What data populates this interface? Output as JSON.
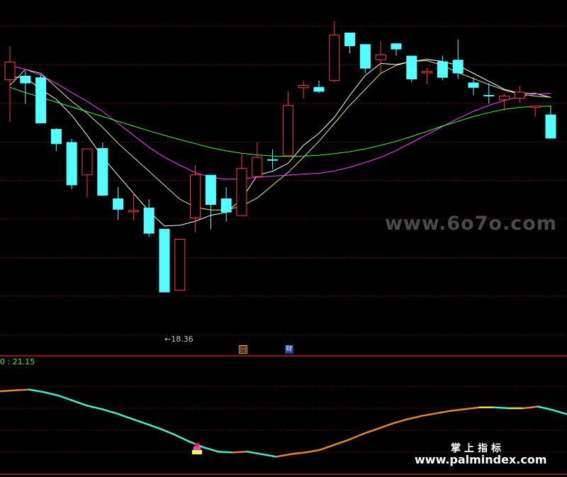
{
  "chart_data": {
    "type": "candlestick",
    "price_range": [
      16.6,
      24.9
    ],
    "candles": [
      {
        "o": 22.94,
        "h": 23.77,
        "l": 21.88,
        "c": 23.38
      },
      {
        "o": 23.04,
        "h": 23.16,
        "l": 22.34,
        "c": 22.85
      },
      {
        "o": 23.0,
        "h": 23.07,
        "l": 21.85,
        "c": 21.85
      },
      {
        "o": 21.71,
        "h": 21.73,
        "l": 21.16,
        "c": 21.33
      },
      {
        "o": 21.38,
        "h": 21.46,
        "l": 20.2,
        "c": 20.3
      },
      {
        "o": 20.56,
        "h": 21.04,
        "l": 20.0,
        "c": 21.21
      },
      {
        "o": 21.23,
        "h": 21.37,
        "l": 20.42,
        "c": 20.04
      },
      {
        "o": 19.97,
        "h": 20.25,
        "l": 19.44,
        "c": 19.69
      },
      {
        "o": 19.67,
        "h": 20.11,
        "l": 19.44,
        "c": 19.67
      },
      {
        "o": 19.74,
        "h": 19.95,
        "l": 19.01,
        "c": 19.09
      },
      {
        "o": 19.21,
        "h": 19.21,
        "l": 18.36,
        "c": 17.62
      },
      {
        "o": 17.67,
        "h": 18.95,
        "l": 17.67,
        "c": 18.95
      },
      {
        "o": 19.48,
        "h": 20.8,
        "l": 19.12,
        "c": 20.56
      },
      {
        "o": 20.56,
        "h": 20.56,
        "l": 19.2,
        "c": 19.81
      },
      {
        "o": 19.97,
        "h": 20.25,
        "l": 19.39,
        "c": 19.62
      },
      {
        "o": 19.54,
        "h": 21.1,
        "l": 19.54,
        "c": 20.72
      },
      {
        "o": 20.52,
        "h": 21.37,
        "l": 20.52,
        "c": 21.0
      },
      {
        "o": 20.95,
        "h": 21.2,
        "l": 20.7,
        "c": 20.93
      },
      {
        "o": 21.04,
        "h": 22.65,
        "l": 21.04,
        "c": 22.3
      },
      {
        "o": 22.74,
        "h": 22.91,
        "l": 22.47,
        "c": 22.8
      },
      {
        "o": 22.76,
        "h": 22.92,
        "l": 22.6,
        "c": 22.64
      },
      {
        "o": 22.92,
        "h": 24.4,
        "l": 22.88,
        "c": 24.06
      },
      {
        "o": 24.12,
        "h": 24.12,
        "l": 23.6,
        "c": 23.78
      },
      {
        "o": 23.83,
        "h": 23.83,
        "l": 23.11,
        "c": 23.22
      },
      {
        "o": 23.44,
        "h": 23.9,
        "l": 23.11,
        "c": 23.56
      },
      {
        "o": 23.85,
        "h": 23.85,
        "l": 23.54,
        "c": 23.7
      },
      {
        "o": 23.54,
        "h": 23.54,
        "l": 22.88,
        "c": 22.95
      },
      {
        "o": 23.11,
        "h": 23.23,
        "l": 22.83,
        "c": 23.15
      },
      {
        "o": 23.4,
        "h": 23.54,
        "l": 22.93,
        "c": 22.99
      },
      {
        "o": 23.44,
        "h": 23.95,
        "l": 22.96,
        "c": 23.1
      },
      {
        "o": 22.87,
        "h": 23.0,
        "l": 22.55,
        "c": 22.74
      },
      {
        "o": 22.56,
        "h": 22.85,
        "l": 22.34,
        "c": 22.53
      },
      {
        "o": 22.44,
        "h": 22.59,
        "l": 22.17,
        "c": 22.53
      },
      {
        "o": 22.48,
        "h": 22.78,
        "l": 22.37,
        "c": 22.63
      },
      {
        "o": 22.27,
        "h": 22.27,
        "l": 22.02,
        "c": 22.28
      },
      {
        "o": 22.07,
        "h": 22.29,
        "l": 21.69,
        "c": 21.47
      }
    ],
    "ma_lines": [
      {
        "name": "",
        "color": "#ffffff",
        "values": [
          23.0,
          23.0,
          22.7,
          22.45,
          22.05,
          21.55,
          21.0,
          20.55,
          20.1,
          19.65,
          19.28,
          19.3,
          19.4,
          19.55,
          19.62,
          19.95,
          20.55,
          20.65,
          20.85,
          21.3,
          21.6,
          22.0,
          22.55,
          23.05,
          23.35,
          23.32,
          23.4,
          23.45,
          23.4,
          23.3,
          23.1,
          22.9,
          22.7,
          22.6,
          22.6,
          22.5
        ]
      },
      {
        "name": "",
        "color": "#e8e88c",
        "values": [
          22.8,
          23.2,
          23.1,
          22.75,
          22.4,
          22.1,
          21.75,
          21.35,
          21.0,
          20.65,
          20.3,
          19.95,
          19.75,
          19.68,
          19.68,
          19.78,
          19.98,
          20.3,
          20.62,
          21.0,
          21.4,
          21.85,
          22.3,
          22.7,
          23.1,
          23.3,
          23.4,
          23.42,
          23.3,
          23.12,
          22.97,
          22.82,
          22.68,
          22.58,
          22.53,
          22.5
        ]
      },
      {
        "name": "",
        "color": "#ff40ff",
        "values": [
          23.3,
          23.2,
          23.05,
          22.85,
          22.62,
          22.4,
          22.15,
          21.85,
          21.55,
          21.25,
          21.0,
          20.8,
          20.62,
          20.5,
          20.45,
          20.46,
          20.5,
          20.53,
          20.55,
          20.58,
          20.6,
          20.66,
          20.75,
          20.87,
          21.0,
          21.17,
          21.37,
          21.57,
          21.77,
          21.97,
          22.15,
          22.3,
          22.42,
          22.52,
          22.58,
          22.6
        ]
      },
      {
        "name": "",
        "color": "#33ff33",
        "values": [
          22.75,
          22.62,
          22.5,
          22.38,
          22.26,
          22.14,
          22.02,
          21.9,
          21.78,
          21.66,
          21.55,
          21.44,
          21.34,
          21.24,
          21.16,
          21.1,
          21.06,
          21.03,
          21.02,
          21.03,
          21.05,
          21.09,
          21.14,
          21.21,
          21.3,
          21.4,
          21.52,
          21.65,
          21.78,
          21.9,
          22.02,
          22.12,
          22.2,
          22.25,
          22.27,
          22.28
        ]
      }
    ],
    "low_label": "←18.36",
    "indicator": {
      "label": "0 : 21.15",
      "range": [
        0,
        1
      ],
      "values": [
        0.9,
        0.91,
        0.92,
        0.89,
        0.85,
        0.79,
        0.73,
        0.69,
        0.64,
        0.58,
        0.52,
        0.46,
        0.39,
        0.31,
        0.24,
        0.19,
        0.18,
        0.19,
        0.16,
        0.13,
        0.16,
        0.18,
        0.21,
        0.27,
        0.33,
        0.4,
        0.46,
        0.52,
        0.57,
        0.61,
        0.64,
        0.67,
        0.69,
        0.71,
        0.71,
        0.7,
        0.7,
        0.72,
        0.68,
        0.63
      ]
    },
    "event_markers": [
      "回",
      "财"
    ]
  },
  "watermarks": [
    "www.6o7o.com",
    "掌上指标",
    "www.palmindex.com"
  ]
}
